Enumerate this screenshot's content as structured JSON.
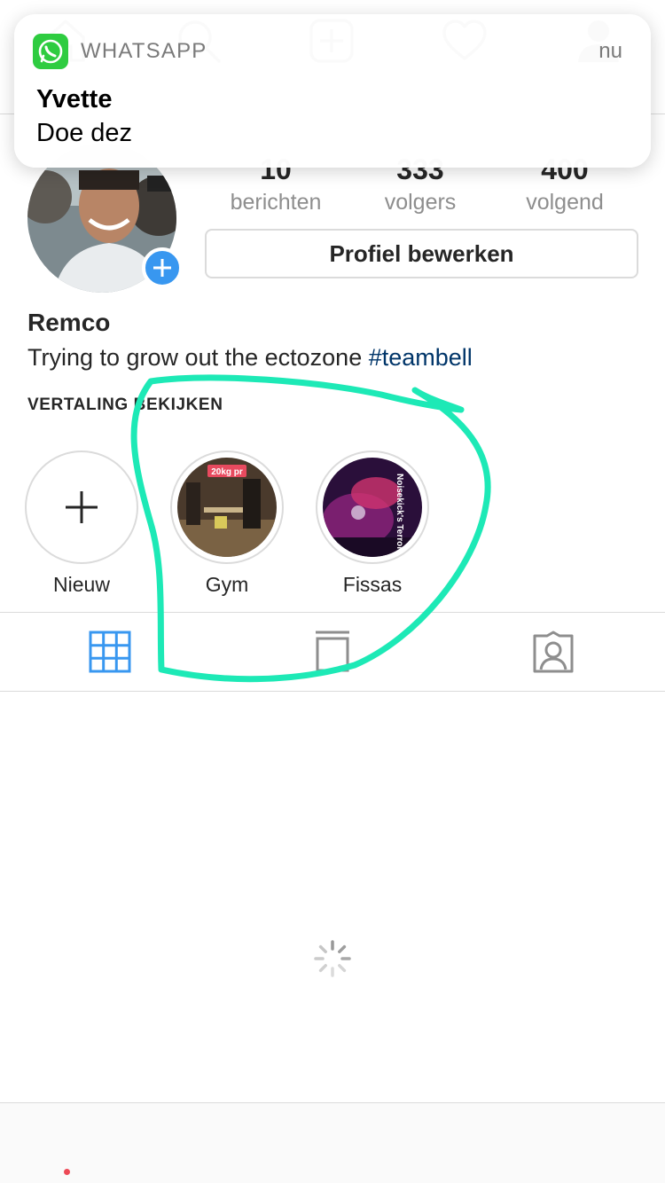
{
  "notification": {
    "app": "WHATSAPP",
    "time": "nu",
    "title": "Yvette",
    "body": "Doe dez",
    "icon": "whatsapp-icon"
  },
  "profile": {
    "stats": [
      {
        "value": "10",
        "label": "berichten"
      },
      {
        "value": "333",
        "label": "volgers"
      },
      {
        "value": "400",
        "label": "volgend"
      }
    ],
    "edit_button": "Profiel bewerken",
    "name": "Remco",
    "bio_text": "Trying to grow out the ectozone ",
    "bio_hashtag": "#teambell",
    "translate_link": "VERTALING BEKIJKEN"
  },
  "highlights": [
    {
      "label": "Nieuw"
    },
    {
      "label": "Gym",
      "overlay_text": "20kg pr"
    },
    {
      "label": "Fissas",
      "overlay_text": "Noisekick's Terrordjang"
    }
  ],
  "tabs": [
    "grid-icon",
    "feed-icon",
    "tagged-icon"
  ],
  "bottom_nav": [
    "home-icon",
    "search-icon",
    "add-icon",
    "heart-icon",
    "profile-icon"
  ],
  "colors": {
    "accent_blue": "#3897f0",
    "hashtag": "#003569",
    "annotation": "#1de9b6",
    "notification_dot": "#ed4956"
  }
}
